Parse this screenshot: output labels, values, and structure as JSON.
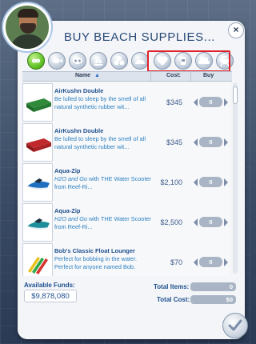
{
  "window": {
    "title": "Buy Beach Supplies..."
  },
  "close_label": "×",
  "filters": [
    {
      "icon": "infinity-icon",
      "active": true
    },
    {
      "icon": "fish-icon",
      "active": false
    },
    {
      "icon": "mask-icon",
      "active": false
    },
    {
      "icon": "sailboat-icon",
      "active": false
    },
    {
      "icon": "bubbles-icon",
      "active": false
    },
    {
      "icon": "shell-icon",
      "active": false
    },
    {
      "icon": "heart-icon",
      "active": false
    },
    {
      "icon": "drink-icon",
      "active": false
    },
    {
      "icon": "sofa-icon",
      "active": false
    },
    {
      "icon": "grill-icon",
      "active": false
    }
  ],
  "columns": {
    "name": "Name",
    "cost": "Cost:",
    "buy": "Buy"
  },
  "items": [
    {
      "name": "AirKushn Double",
      "desc": "Be lulled to sleep by the smell of all natural synthetic rubber wit...",
      "price": "$345",
      "qty": "0",
      "thumb": "green-air-mattress"
    },
    {
      "name": "AirKushn Double",
      "desc": "Be lulled to sleep by the smell of all natural synthetic rubber wit...",
      "price": "$345",
      "qty": "0",
      "thumb": "red-air-mattress"
    },
    {
      "name": "Aqua-Zip",
      "desc_em": "H2O and Go",
      "desc_rest": " with THE Water Scooter from Reef-Ri...",
      "price": "$2,100",
      "qty": "0",
      "thumb": "blue-jetski"
    },
    {
      "name": "Aqua-Zip",
      "desc_em": "H2O and Go",
      "desc_rest": " with THE Water Scooter from Reef-Ri...",
      "price": "$2,500",
      "qty": "0",
      "thumb": "teal-jetski"
    },
    {
      "name": "Bob's Classic Float Lounger",
      "desc": "Perfect for bobbing in the water. Perfect for anyone named Bob.",
      "price": "$70",
      "qty": "0",
      "thumb": "striped-float"
    }
  ],
  "footer": {
    "funds_label": "Available Funds:",
    "funds_value": "$9,878,080",
    "total_items_label": "Total Items:",
    "total_items_value": "0",
    "total_cost_label": "Total Cost:",
    "total_cost_value": "$0"
  },
  "colors": {
    "accent": "#1d4e8d",
    "highlight": "#e0222a",
    "active_filter": "#5fbf24"
  }
}
